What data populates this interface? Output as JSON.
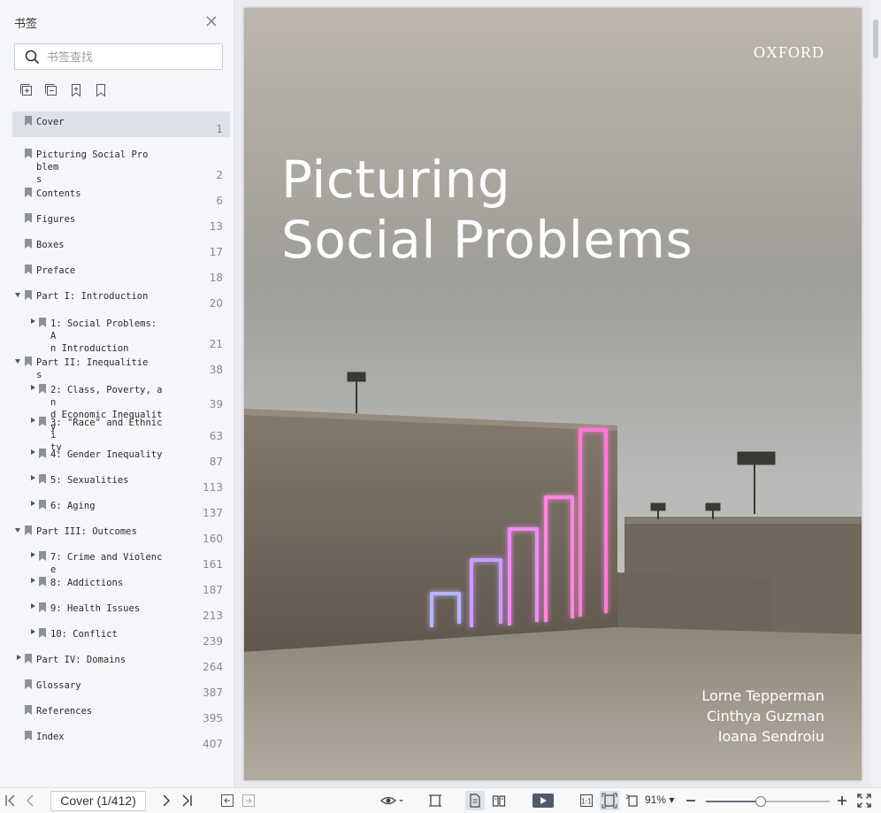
{
  "sidebar": {
    "title": "书签",
    "search_placeholder": "书签查找",
    "bookmarks": [
      {
        "label": "Cover",
        "page": "1",
        "level": 0,
        "expander": "none",
        "selected": true
      },
      {
        "label": "Picturing Social Problem\ns",
        "page": "2",
        "level": 0,
        "expander": "none"
      },
      {
        "label": "Contents",
        "page": "6",
        "level": 0,
        "expander": "none"
      },
      {
        "label": "Figures",
        "page": "13",
        "level": 0,
        "expander": "none"
      },
      {
        "label": "Boxes",
        "page": "17",
        "level": 0,
        "expander": "none"
      },
      {
        "label": "Preface",
        "page": "18",
        "level": 0,
        "expander": "none"
      },
      {
        "label": "Part I: Introduction",
        "page": "20",
        "level": 0,
        "expander": "expanded"
      },
      {
        "label": "1: Social Problems: A\nn Introduction",
        "page": "21",
        "level": 1,
        "expander": "collapsed"
      },
      {
        "label": "Part II: Inequalities",
        "page": "38",
        "level": 0,
        "expander": "expanded"
      },
      {
        "label": "2: Class, Poverty, an\nd Economic Inequality",
        "page": "39",
        "level": 1,
        "expander": "collapsed"
      },
      {
        "label": "3: \"Race\" and Ethnici\nty",
        "page": "63",
        "level": 1,
        "expander": "collapsed"
      },
      {
        "label": "4: Gender Inequality",
        "page": "87",
        "level": 1,
        "expander": "collapsed"
      },
      {
        "label": "5: Sexualities",
        "page": "113",
        "level": 1,
        "expander": "collapsed"
      },
      {
        "label": "6: Aging",
        "page": "137",
        "level": 1,
        "expander": "collapsed"
      },
      {
        "label": "Part III: Outcomes",
        "page": "160",
        "level": 0,
        "expander": "expanded"
      },
      {
        "label": "7: Crime and Violence",
        "page": "161",
        "level": 1,
        "expander": "collapsed"
      },
      {
        "label": "8: Addictions",
        "page": "187",
        "level": 1,
        "expander": "collapsed"
      },
      {
        "label": "9: Health Issues",
        "page": "213",
        "level": 1,
        "expander": "collapsed"
      },
      {
        "label": "10: Conflict",
        "page": "239",
        "level": 1,
        "expander": "collapsed"
      },
      {
        "label": "Part IV: Domains",
        "page": "264",
        "level": 0,
        "expander": "collapsed"
      },
      {
        "label": "Glossary",
        "page": "387",
        "level": 0,
        "expander": "none"
      },
      {
        "label": "References",
        "page": "395",
        "level": 0,
        "expander": "none"
      },
      {
        "label": "Index",
        "page": "407",
        "level": 0,
        "expander": "none"
      }
    ]
  },
  "document": {
    "publisher": "OXFORD",
    "title_line1": "Picturing",
    "title_line2": "Social Problems",
    "authors": [
      "Lorne Tepperman",
      "Cinthya Guzman",
      "Ioana Sendroiu"
    ]
  },
  "toolbar": {
    "page_indicator": "Cover (1/412)",
    "zoom": "91%",
    "zoom_fraction": 0.44
  },
  "colors": {
    "sidebar_bg": "#f5f6f9",
    "selected_row": "#dde1e9",
    "sky": "#b9b5ae",
    "concrete": "#7c7365",
    "neon_pink": "#ff7ad6",
    "neon_violet": "#a78bff"
  }
}
